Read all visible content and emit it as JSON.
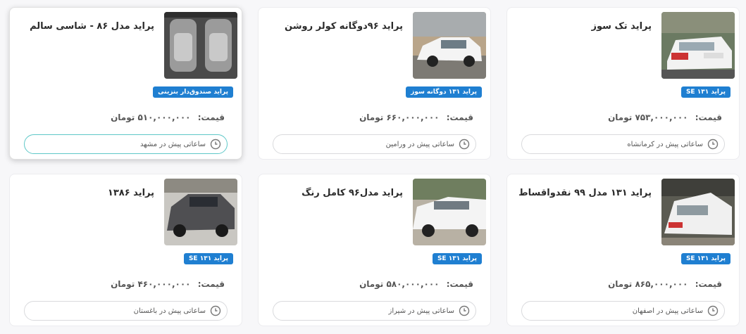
{
  "listings": [
    {
      "title": "پراید تک سوز",
      "badge": "پراید ۱۳۱ SE",
      "price_label": "قیمت:",
      "price": "۷۵۳,۰۰۰,۰۰۰ تومان",
      "meta": "ساعاتی پیش در کرمانشاه",
      "photo": "white-car-rear-icon"
    },
    {
      "title": "پراید ۹۶دوگانه کولر روشن",
      "badge": "پراید ۱۳۱ دوگانه سوز",
      "price_label": "قیمت:",
      "price": "۶۶۰,۰۰۰,۰۰۰ تومان",
      "meta": "ساعاتی پیش در ورامین",
      "photo": "white-car-side-icon"
    },
    {
      "title": "پراید مدل ۸۶ - شاسی سالم",
      "badge": "پراید صندوق‌دار بنزینی",
      "price_label": "قیمت:",
      "price": "۵۱۰,۰۰۰,۰۰۰ تومان",
      "meta": "ساعاتی پیش در مشهد",
      "photo": "car-seat-icon"
    },
    {
      "title": "پراید ۱۳۱ مدل ۹۹ نقدواقساط",
      "badge": "پراید ۱۳۱ SE",
      "price_label": "قیمت:",
      "price": "۸۶۵,۰۰۰,۰۰۰ تومان",
      "meta": "ساعاتی پیش در اصفهان",
      "photo": "white-car-rear-icon"
    },
    {
      "title": "پراید مدل۹۶ کامل رنگ",
      "badge": "پراید ۱۳۱ SE",
      "price_label": "قیمت:",
      "price": "۵۸۰,۰۰۰,۰۰۰ تومان",
      "meta": "ساعاتی پیش در شیراز",
      "photo": "white-car-side-icon"
    },
    {
      "title": "پراید ۱۳۸۶",
      "badge": "پراید ۱۳۱ SE",
      "price_label": "قیمت:",
      "price": "۴۶۰,۰۰۰,۰۰۰ تومان",
      "meta": "ساعاتی پیش در باغستان",
      "photo": "gray-car-icon"
    }
  ],
  "colors": {
    "badge": "#1f7fd1",
    "active_border": "#5ec8c8"
  }
}
